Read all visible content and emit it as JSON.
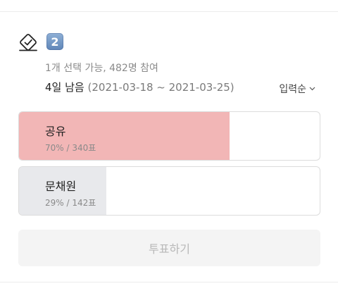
{
  "poll": {
    "number_badge": "2",
    "icon": "ballot-check-icon",
    "meta": "1개 선택 가능, 482명 참여",
    "remaining": "4일 남음",
    "period": "(2021-03-18 ~ 2021-03-25)",
    "sort_label": "입력순",
    "options": [
      {
        "label": "공유",
        "stat": "70% / 340표",
        "fraction": 0.7,
        "color": "#f2b6b6"
      },
      {
        "label": "문채원",
        "stat": "29% / 142표",
        "fraction": 0.29,
        "color": "#e8e9ec"
      }
    ],
    "vote_button": "투표하기"
  }
}
